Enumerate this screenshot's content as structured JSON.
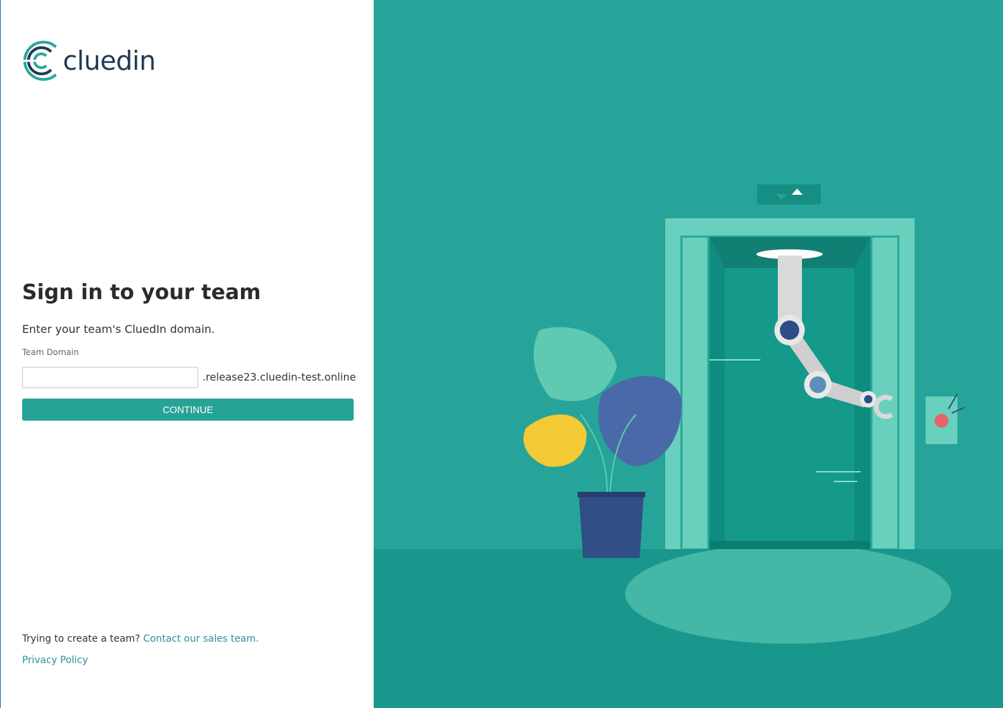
{
  "brand": {
    "name": "cluedin",
    "logo_icon": "cluedin-c-logo-icon",
    "colors": {
      "text": "#1f3a56",
      "accent": "#2aa89a"
    }
  },
  "signin": {
    "title": "Sign in to your team",
    "subtitle": "Enter your team's CluedIn domain.",
    "field_label": "Team Domain",
    "domain_value": "",
    "domain_placeholder": "",
    "domain_suffix": ".release23.cluedin-test.online",
    "continue_label": "CONTINUE"
  },
  "footer": {
    "create_team_text": "Trying to create a team?",
    "contact_link": "Contact our sales team.",
    "privacy_link": "Privacy Policy"
  },
  "illustration": {
    "name": "robot-arm-elevator-illustration",
    "background": "#27a499"
  }
}
